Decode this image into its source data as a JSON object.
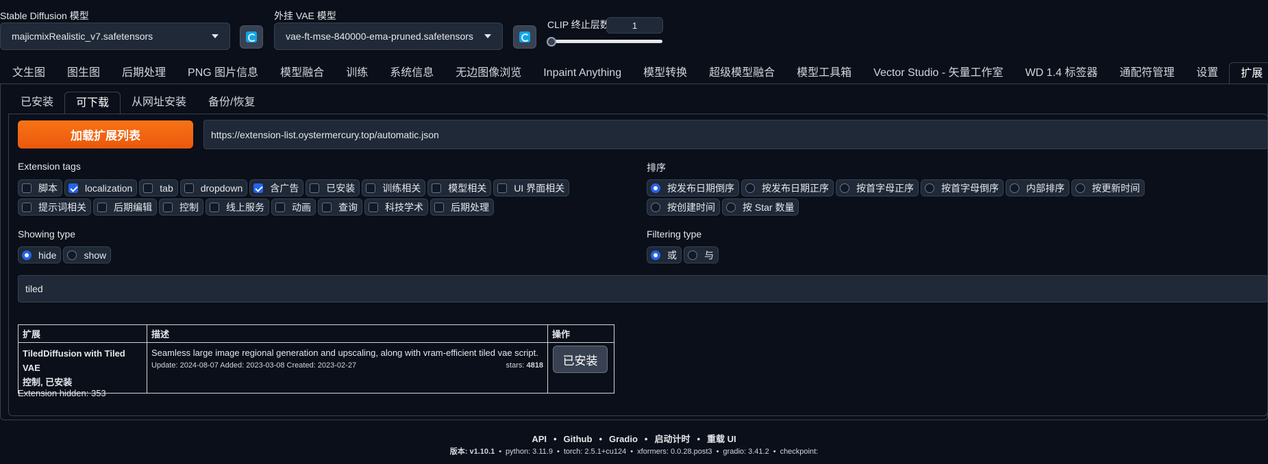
{
  "models": {
    "sd_label": "Stable Diffusion 模型",
    "sd_value": "majicmixRealistic_v7.safetensors",
    "vae_label": "外挂 VAE 模型",
    "vae_value": "vae-ft-mse-840000-ema-pruned.safetensors",
    "clip_label": "CLIP 终止层数",
    "clip_value": "1"
  },
  "main_tabs": [
    "文生图",
    "图生图",
    "后期处理",
    "PNG 图片信息",
    "模型融合",
    "训练",
    "系统信息",
    "无边图像浏览",
    "Inpaint Anything",
    "模型转换",
    "超级模型融合",
    "模型工具箱",
    "Vector Studio - 矢量工作室",
    "WD 1.4 标签器",
    "通配符管理",
    "设置",
    "扩展"
  ],
  "sub_tabs": [
    "已安装",
    "可下载",
    "从网址安装",
    "备份/恢复"
  ],
  "load_button": "加载扩展列表",
  "index_url": "https://extension-list.oystermercury.top/automatic.json",
  "tags": {
    "title": "Extension tags",
    "items": [
      {
        "label": "脚本",
        "checked": false
      },
      {
        "label": "localization",
        "checked": true
      },
      {
        "label": "tab",
        "checked": false
      },
      {
        "label": "dropdown",
        "checked": false
      },
      {
        "label": "含广告",
        "checked": true
      },
      {
        "label": "已安装",
        "checked": false
      },
      {
        "label": "训练相关",
        "checked": false
      },
      {
        "label": "模型相关",
        "checked": false
      },
      {
        "label": "UI 界面相关",
        "checked": false
      },
      {
        "label": "提示词相关",
        "checked": false
      },
      {
        "label": "后期编辑",
        "checked": false
      },
      {
        "label": "控制",
        "checked": false
      },
      {
        "label": "线上服务",
        "checked": false
      },
      {
        "label": "动画",
        "checked": false
      },
      {
        "label": "查询",
        "checked": false
      },
      {
        "label": "科技学术",
        "checked": false
      },
      {
        "label": "后期处理",
        "checked": false
      }
    ]
  },
  "sort": {
    "title": "排序",
    "items": [
      {
        "label": "按发布日期倒序",
        "selected": true
      },
      {
        "label": "按发布日期正序",
        "selected": false
      },
      {
        "label": "按首字母正序",
        "selected": false
      },
      {
        "label": "按首字母倒序",
        "selected": false
      },
      {
        "label": "内部排序",
        "selected": false
      },
      {
        "label": "按更新时间",
        "selected": false
      },
      {
        "label": "按创建时间",
        "selected": false
      },
      {
        "label": "按 Star 数量",
        "selected": false
      }
    ]
  },
  "showing": {
    "title": "Showing type",
    "items": [
      {
        "label": "hide",
        "selected": true
      },
      {
        "label": "show",
        "selected": false
      }
    ]
  },
  "filtering": {
    "title": "Filtering type",
    "items": [
      {
        "label": "或",
        "selected": true
      },
      {
        "label": "与",
        "selected": false
      }
    ]
  },
  "search_value": "tiled",
  "table": {
    "headers": [
      "扩展",
      "描述",
      "操作"
    ],
    "row": {
      "name": "TiledDiffusion with Tiled VAE",
      "tags": "控制, 已安装",
      "description": "Seamless large image regional generation and upscaling, along with vram-efficient tiled vae script.",
      "dates": "Update: 2024-08-07 Added: 2023-03-08 Created: 2023-02-27",
      "stars_label": "stars:",
      "stars": "4818",
      "action": "已安装"
    }
  },
  "hidden_text": "Extension hidden: 353",
  "footer": {
    "links": [
      "API",
      "Github",
      "Gradio",
      "启动计时",
      "重载 UI"
    ],
    "sep": "•",
    "versions": [
      "版本: v1.10.1",
      "python: 3.11.9",
      "torch: 2.5.1+cu124",
      "xformers: 0.0.28.post3",
      "gradio: 3.41.2",
      "checkpoint:"
    ]
  }
}
